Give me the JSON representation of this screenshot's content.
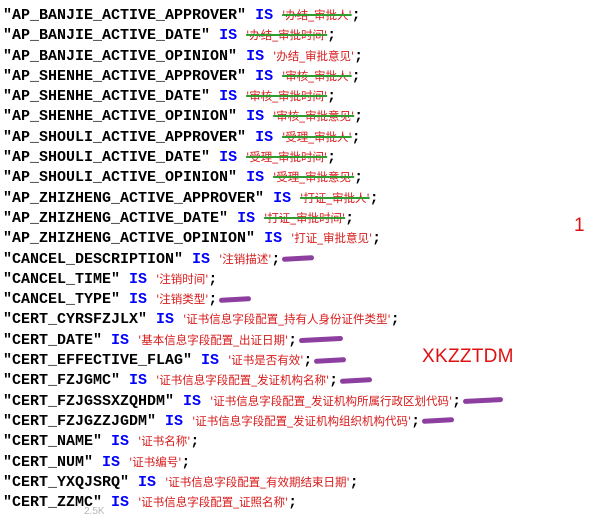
{
  "editor": {
    "keyword": "IS",
    "lines": [
      {
        "key": "\"AP_BANJIE_ACTIVE_APPROVER\"",
        "value": "'办结_审批人'",
        "strike": true,
        "mark": false
      },
      {
        "key": "\"AP_BANJIE_ACTIVE_DATE\"",
        "value": "'办结_审批时间'",
        "strike": true,
        "mark": false
      },
      {
        "key": "\"AP_BANJIE_ACTIVE_OPINION\"",
        "value": "'办结_审批意见'",
        "strike": false,
        "mark": false
      },
      {
        "key": "\"AP_SHENHE_ACTIVE_APPROVER\"",
        "value": "'审核_审批人'",
        "strike": true,
        "mark": false
      },
      {
        "key": "\"AP_SHENHE_ACTIVE_DATE\"",
        "value": "'审核_审批时间'",
        "strike": true,
        "mark": false
      },
      {
        "key": "\"AP_SHENHE_ACTIVE_OPINION\"",
        "value": "'审核_审批意见'",
        "strike": true,
        "mark": false
      },
      {
        "key": "\"AP_SHOULI_ACTIVE_APPROVER\"",
        "value": "'受理_审批人'",
        "strike": true,
        "mark": false
      },
      {
        "key": "\"AP_SHOULI_ACTIVE_DATE\"",
        "value": "'受理_审批时间'",
        "strike": true,
        "mark": false
      },
      {
        "key": "\"AP_SHOULI_ACTIVE_OPINION\"",
        "value": "'受理_审批意见'",
        "strike": true,
        "mark": false
      },
      {
        "key": "\"AP_ZHIZHENG_ACTIVE_APPROVER\"",
        "value": "'打证_审批人'",
        "strike": true,
        "mark": false
      },
      {
        "key": "\"AP_ZHIZHENG_ACTIVE_DATE\"",
        "value": "'打证_审批时间'",
        "strike": true,
        "mark": false
      },
      {
        "key": "\"AP_ZHIZHENG_ACTIVE_OPINION\"",
        "value": "'打证_审批意见'",
        "strike": false,
        "mark": false
      },
      {
        "key": "\"CANCEL_DESCRIPTION\"",
        "value": "'注销描述'",
        "strike": false,
        "mark": true
      },
      {
        "key": "\"CANCEL_TIME\"",
        "value": "'注销时间'",
        "strike": false,
        "mark": false
      },
      {
        "key": "\"CANCEL_TYPE\"",
        "value": "'注销类型'",
        "strike": false,
        "mark": true
      },
      {
        "key": "\"CERT_CYRSFZJLX\"",
        "value": "'证书信息字段配置_持有人身份证件类型'",
        "strike": false,
        "mark": false
      },
      {
        "key": "\"CERT_DATE\"",
        "value": "'基本信息字段配置_出证日期'",
        "strike": false,
        "mark": true
      },
      {
        "key": "\"CERT_EFFECTIVE_FLAG\"",
        "value": "'证书是否有效'",
        "strike": false,
        "mark": true
      },
      {
        "key": "\"CERT_FZJGMC\"",
        "value": "'证书信息字段配置_发证机构名称'",
        "strike": false,
        "mark": true
      },
      {
        "key": "\"CERT_FZJGSSXZQHDM\"",
        "value": "'证书信息字段配置_发证机构所属行政区划代码'",
        "strike": false,
        "mark": true
      },
      {
        "key": "\"CERT_FZJGZZJGDM\"",
        "value": "'证书信息字段配置_发证机构组织机构代码'",
        "strike": false,
        "mark": true
      },
      {
        "key": "\"CERT_NAME\"",
        "value": "'证书名称'",
        "strike": false,
        "mark": false
      },
      {
        "key": "\"CERT_NUM\"",
        "value": "'证书编号'",
        "strike": false,
        "mark": false
      },
      {
        "key": "\"CERT_YXQJSRQ\"",
        "value": "'证书信息字段配置_有效期结束日期'",
        "strike": false,
        "mark": false
      },
      {
        "key": "\"CERT_ZZMC\"",
        "value": "'证书信息字段配置_证照名称'",
        "strike": false,
        "mark": false
      }
    ]
  },
  "annotations": {
    "number_note": "1",
    "text_note": "XKZZTDM"
  },
  "bottom_fragment": "2.5K"
}
